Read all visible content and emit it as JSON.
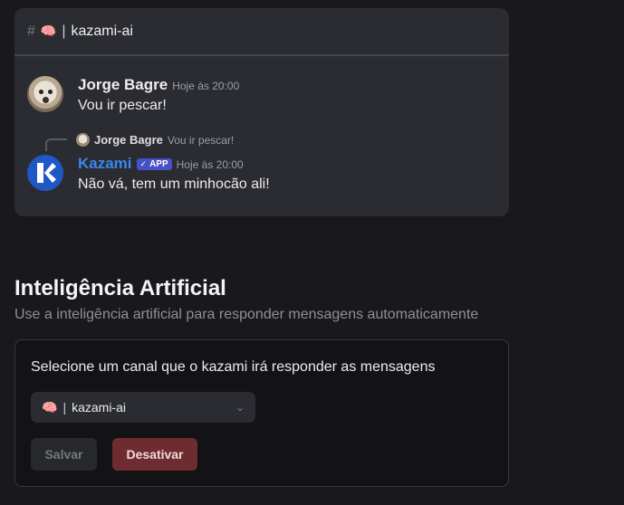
{
  "preview": {
    "hash": "#",
    "channel_emoji": "🧠",
    "channel_sep": "|",
    "channel_name": "kazami-ai",
    "message1": {
      "author": "Jorge Bagre",
      "time": "Hoje às 20:00",
      "content": "Vou ir pescar!"
    },
    "reply_ref": {
      "author": "Jorge Bagre",
      "text": "Vou ir pescar!"
    },
    "message2": {
      "author": "Kazami",
      "badge_check": "✓",
      "badge": "APP",
      "time": "Hoje às 20:00",
      "content": "Não vá, tem um minhocão ali!"
    }
  },
  "section": {
    "title": "Inteligência Artificial",
    "subtitle": "Use a inteligência artificial para responder mensagens automaticamente"
  },
  "card": {
    "label": "Selecione um canal que o kazami irá responder as mensagens",
    "select": {
      "emoji": "🧠",
      "sep": "|",
      "value": "kazami-ai",
      "chevron": "⌄"
    },
    "save_label": "Salvar",
    "deactivate_label": "Desativar"
  },
  "colors": {
    "accent_blue": "#3a86ef",
    "app_badge": "#4651c7",
    "danger": "#6e2c31"
  },
  "icons": [
    "hash-icon",
    "brain-emoji-icon",
    "chevron-down-icon",
    "check-icon"
  ]
}
